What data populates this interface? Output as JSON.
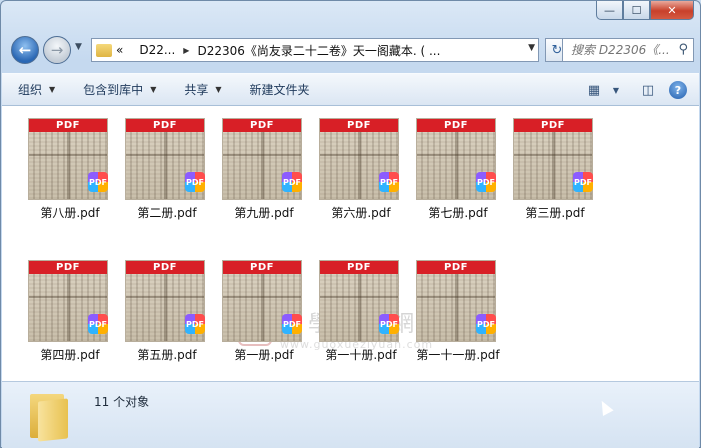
{
  "window": {
    "controls": {
      "minimize": "—",
      "maximize": "☐",
      "close": "✕"
    }
  },
  "nav": {
    "back_icon": "back-arrow-icon",
    "forward_icon": "forward-arrow-icon",
    "breadcrumb": {
      "overflow": "«",
      "parent": "D22...",
      "current": "D22306《尚友录二十二卷》天一阁藏本. ( ..."
    },
    "search_placeholder": "搜索 D22306《..."
  },
  "toolbar": {
    "organize": "组织",
    "include_in_library": "包含到库中",
    "share": "共享",
    "new_folder": "新建文件夹"
  },
  "thumb_label": "PDF",
  "badge_label": "PDF",
  "files": [
    {
      "name": "第八册.pdf"
    },
    {
      "name": "第二册.pdf"
    },
    {
      "name": "第九册.pdf"
    },
    {
      "name": "第六册.pdf"
    },
    {
      "name": "第七册.pdf"
    },
    {
      "name": "第三册.pdf"
    },
    {
      "name": "第四册.pdf"
    },
    {
      "name": "第五册.pdf"
    },
    {
      "name": "第一册.pdf"
    },
    {
      "name": "第一十册.pdf"
    },
    {
      "name": "第一十一册.pdf"
    }
  ],
  "watermark": {
    "seal": "国",
    "title": "國學資源網",
    "url": "www.guoxueziyuan.com"
  },
  "status": {
    "count_text": "11 个对象"
  },
  "colors": {
    "pdf_bar": "#d81f26",
    "window_frame": "#c5d9ef",
    "close_button": "#c8402a"
  }
}
